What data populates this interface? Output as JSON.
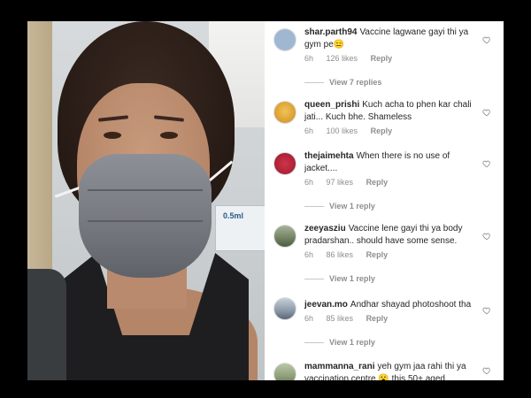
{
  "comments": [
    {
      "username": "shar.parth94",
      "text": "Vaccine lagwane gayi thi ya gym pe😑",
      "time": "6h",
      "likes": "126 likes",
      "reply": "Reply",
      "view_replies": "View 7 replies",
      "avatar_color": "#9fb7d0"
    },
    {
      "username": "queen_prishi",
      "text": "Kuch acha to phen kar chali jati... Kuch bhe.  Shameless",
      "time": "6h",
      "likes": "100 likes",
      "reply": "Reply",
      "view_replies": "",
      "avatar_color": "#e0a83a"
    },
    {
      "username": "thejaimehta",
      "text": "When there is no use of jacket....",
      "time": "6h",
      "likes": "97 likes",
      "reply": "Reply",
      "view_replies": "View 1 reply",
      "avatar_color": "#b0243a"
    },
    {
      "username": "zeeyasziu",
      "text": "Vaccine lene gayi thi ya body pradarshan.. should have some sense.",
      "time": "6h",
      "likes": "86 likes",
      "reply": "Reply",
      "view_replies": "View 1 reply",
      "avatar_color": "#7a8a6a"
    },
    {
      "username": "jeevan.mo",
      "text": "Andhar shayad photoshoot  tha",
      "time": "6h",
      "likes": "85 likes",
      "reply": "Reply",
      "view_replies": "View 1 reply",
      "avatar_color": "#8a98a8"
    },
    {
      "username": "mammanna_rani",
      "text": "yeh gym jaa rahi thi ya vaccination centre 😮 this 50+ aged",
      "time": "",
      "likes": "",
      "reply": "",
      "view_replies": "",
      "avatar_color": "#8fa07a"
    }
  ],
  "photo": {
    "box_label": "0.5ml"
  }
}
